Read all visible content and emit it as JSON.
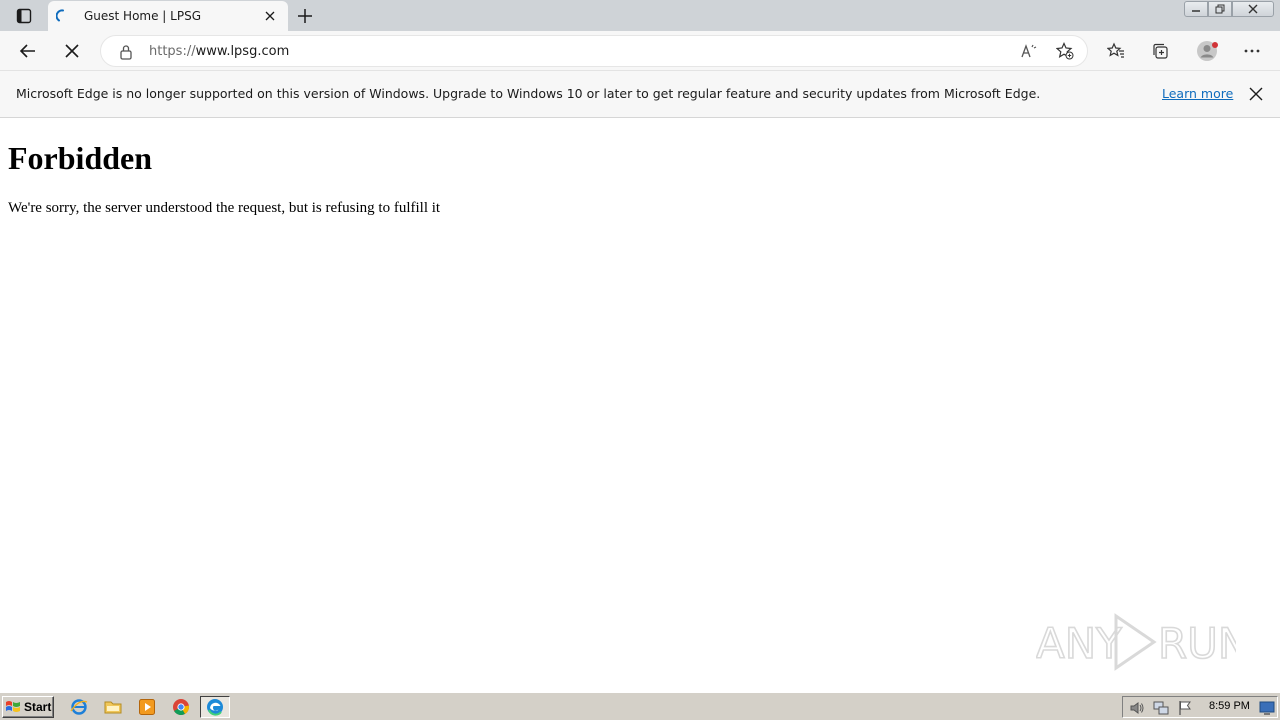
{
  "browser": {
    "tab": {
      "title": "Guest Home | LPSG"
    },
    "address": {
      "scheme": "https://",
      "host": "www.lpsg.com"
    },
    "infobar": {
      "message": "Microsoft Edge is no longer supported on this version of Windows. Upgrade to Windows 10 or later to get regular feature and security updates from Microsoft Edge.",
      "link_label": "Learn more"
    },
    "colors": {
      "link": "#0f6cbd",
      "tabstrip": "#cfd3d7",
      "toolbar": "#f7f7f7"
    }
  },
  "page": {
    "heading": "Forbidden",
    "message": "We're sorry, the server understood the request, but is refusing to fulfill it"
  },
  "watermark": {
    "text_left": "ANY",
    "text_right": "RUN"
  },
  "taskbar": {
    "start_label": "Start",
    "quick_launch": [
      "internet-explorer-icon",
      "folder-icon",
      "media-player-icon",
      "chrome-icon"
    ],
    "active_task": "edge-icon",
    "clock": "8:59 PM"
  }
}
